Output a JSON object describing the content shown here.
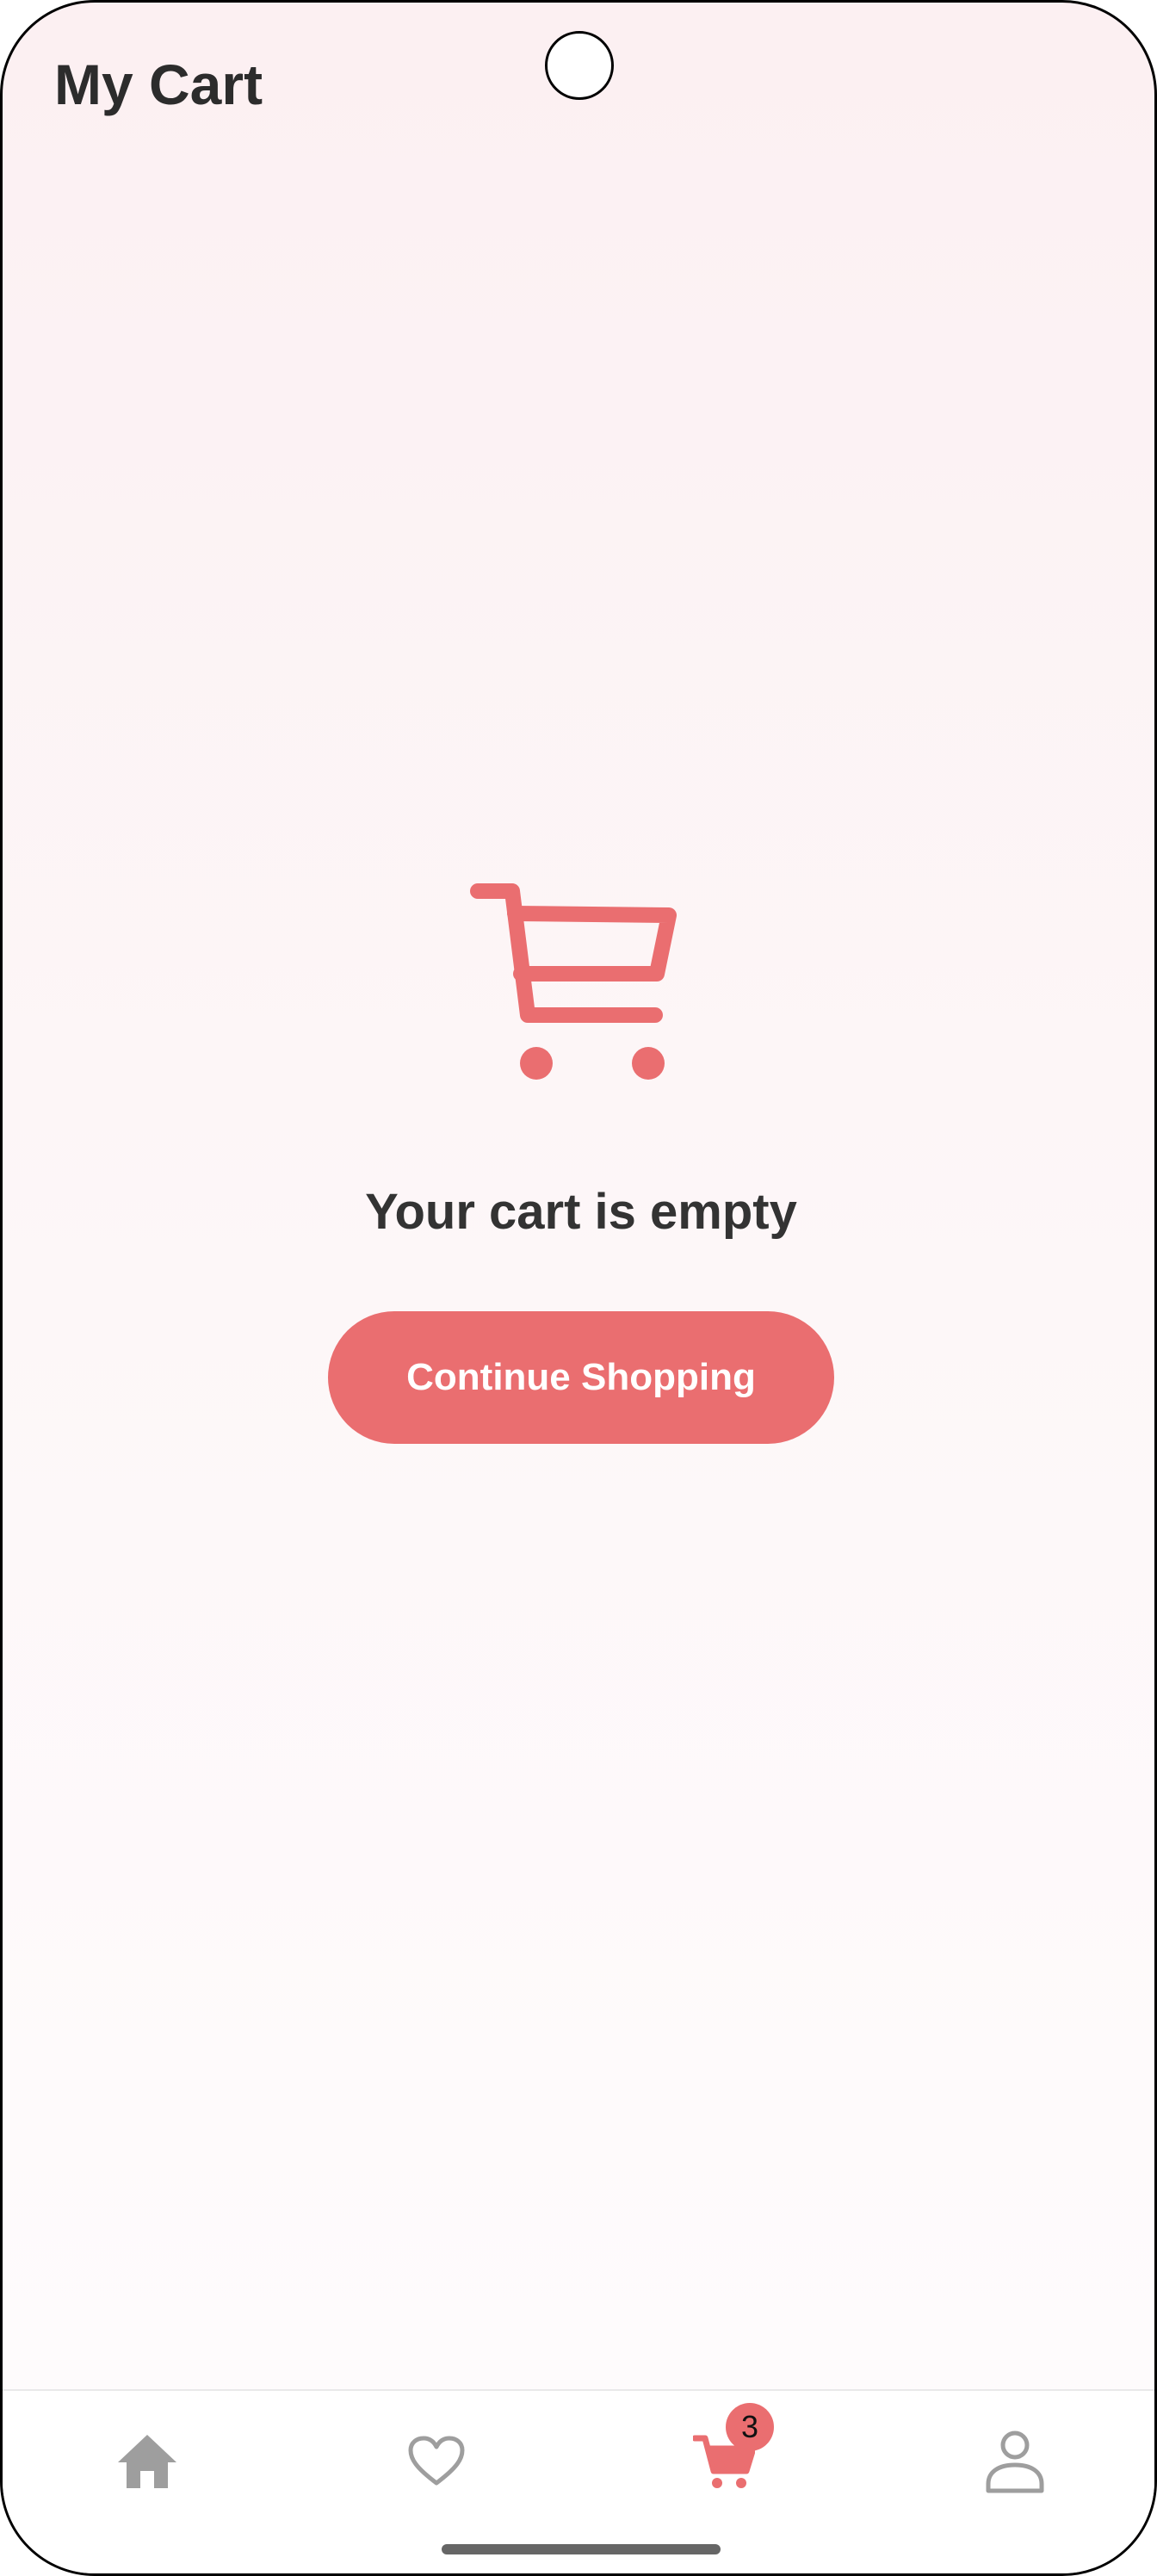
{
  "header": {
    "title": "My Cart"
  },
  "empty_state": {
    "illustration_icon": "shopping-cart-icon",
    "message": "Your cart is empty",
    "button_label": "Continue Shopping"
  },
  "bottom_nav": {
    "items": [
      {
        "name": "home",
        "icon": "home-icon",
        "active": false
      },
      {
        "name": "favorites",
        "icon": "heart-icon",
        "active": false
      },
      {
        "name": "cart",
        "icon": "cart-icon",
        "active": true,
        "badge": "3"
      },
      {
        "name": "profile",
        "icon": "person-icon",
        "active": false
      }
    ]
  },
  "colors": {
    "accent": "#ea6e70",
    "inactive_icon": "#9e9e9e",
    "title_text": "#2c2c2c"
  }
}
